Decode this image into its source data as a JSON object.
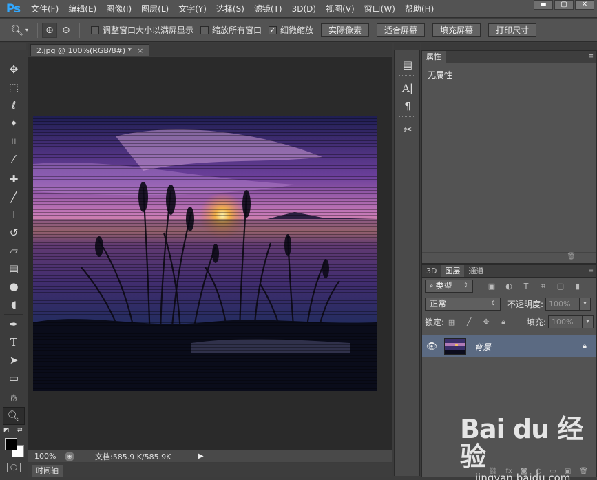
{
  "app": {
    "logo": "Ps"
  },
  "menu": [
    "文件(F)",
    "编辑(E)",
    "图像(I)",
    "图层(L)",
    "文字(Y)",
    "选择(S)",
    "滤镜(T)",
    "3D(D)",
    "视图(V)",
    "窗口(W)",
    "帮助(H)"
  ],
  "window_controls": {
    "minimize": "▬",
    "maximize": "▢",
    "close": "✕"
  },
  "options": {
    "resize_windows_label": "调整窗口大小以满屏显示",
    "resize_windows_checked": false,
    "zoom_all_label": "缩放所有窗口",
    "zoom_all_checked": false,
    "scrubby_label": "细微缩放",
    "scrubby_checked": true,
    "actual_pixels": "实际像素",
    "fit_screen": "适合屏幕",
    "fill_screen": "填充屏幕",
    "print_size": "打印尺寸"
  },
  "document": {
    "tab_title": "2.jpg @ 100%(RGB/8#) *",
    "close_glyph": "×",
    "zoom": "100%",
    "doc_size": "文档:585.9 K/585.9K",
    "timeline": "时间轴"
  },
  "properties": {
    "tab": "属性",
    "empty": "无属性"
  },
  "layers_panel": {
    "tabs": [
      "3D",
      "图层",
      "通道"
    ],
    "active_tab": "图层",
    "filter_kind": "类型",
    "blend_mode": "正常",
    "opacity_label": "不透明度:",
    "opacity_value": "100%",
    "lock_label": "锁定:",
    "fill_label": "填充:",
    "fill_value": "100%",
    "layers": [
      {
        "name": "背景",
        "visible": true,
        "locked": true
      }
    ]
  },
  "watermark": {
    "logo": "Bai du 经验",
    "url": "jingyan.baidu.com"
  }
}
